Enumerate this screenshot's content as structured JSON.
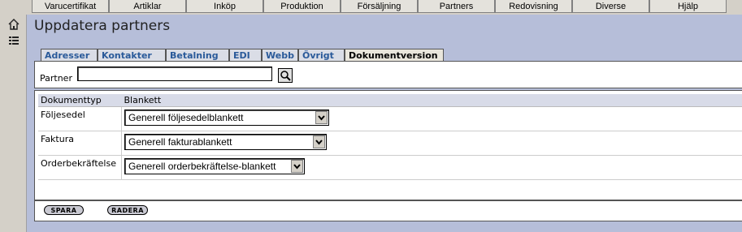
{
  "topnav": {
    "items": [
      "Varucertifikat",
      "Artiklar",
      "Inköp",
      "Produktion",
      "Försäljning",
      "Partners",
      "Redovisning",
      "Diverse",
      "Hjälp"
    ]
  },
  "leftbar": {
    "icons": [
      "home-icon",
      "list-icon"
    ]
  },
  "page": {
    "title": "Uppdatera partners"
  },
  "tabs": [
    "Adresser",
    "Kontakter",
    "Betalning",
    "EDI",
    "Webb",
    "Övrigt",
    "Dokumentversion"
  ],
  "active_tab": "Dokumentversion",
  "partner": {
    "label": "Partner",
    "value": ""
  },
  "table": {
    "headers": [
      "Dokumenttyp",
      "Blankett"
    ],
    "rows": [
      {
        "type": "Följesedel",
        "value": "Generell följesedelblankett"
      },
      {
        "type": "Faktura",
        "value": "Generell fakturablankett"
      },
      {
        "type": "Orderbekräftelse",
        "value": "Generell orderbekräftelse-blankett"
      }
    ]
  },
  "buttons": {
    "save": "SPARA",
    "delete": "RADERA"
  },
  "colors": {
    "panel_bg": "#b6bed9",
    "tab_text": "#2a5a9a",
    "header_bg": "#d8dbe8"
  }
}
